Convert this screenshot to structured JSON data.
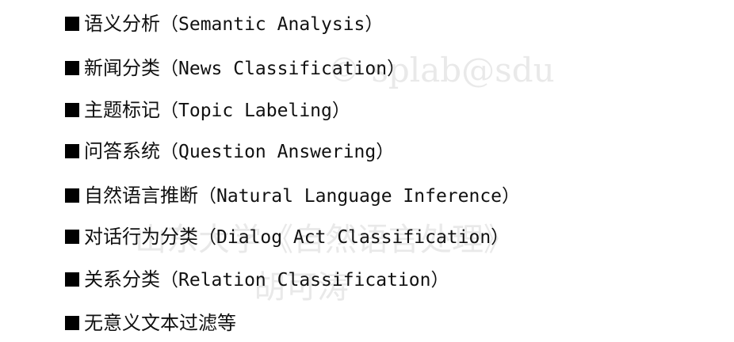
{
  "watermark": {
    "line1": "© splab@sdu",
    "line2": "山东大学《自然语言处理》",
    "line3": "胡可涛"
  },
  "items": [
    {
      "cn": "语义分析",
      "en": "（Semantic Analysis）"
    },
    {
      "cn": "新闻分类",
      "en": "（News Classification）"
    },
    {
      "cn": "主题标记",
      "en": "（Topic Labeling）"
    },
    {
      "cn": "问答系统",
      "en": "（Question Answering）"
    },
    {
      "cn": "自然语言推断",
      "en": "（Natural Language Inference）"
    },
    {
      "cn": "对话行为分类",
      "en": "（Dialog Act Classification）"
    },
    {
      "cn": "关系分类",
      "en": "（Relation Classification）"
    },
    {
      "cn": "无意义文本过滤等",
      "en": ""
    }
  ]
}
